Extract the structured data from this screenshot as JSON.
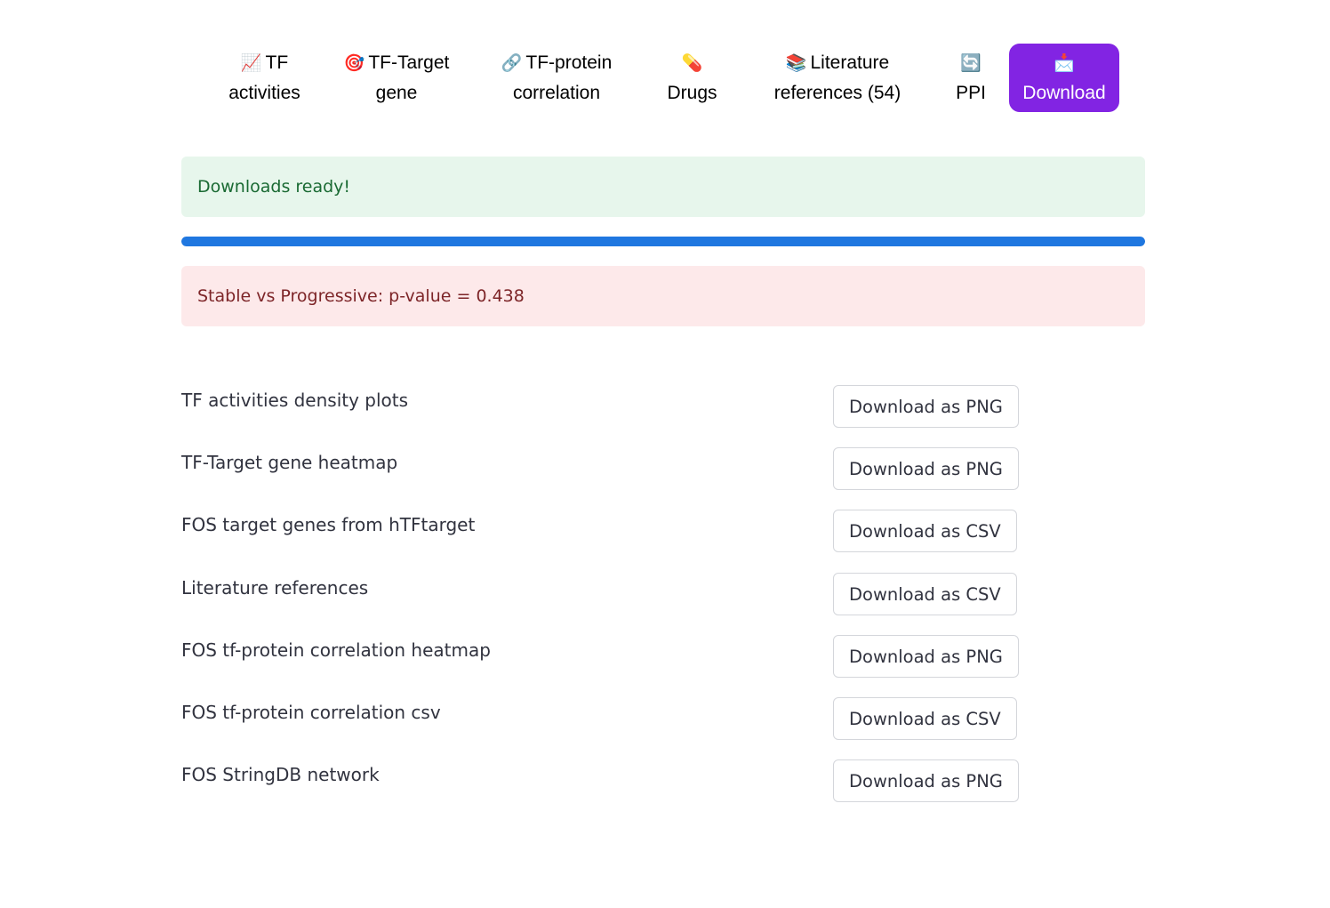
{
  "nav": {
    "tabs": [
      {
        "icon": "📈",
        "icon_name": "chart-increasing-icon",
        "line1": "TF",
        "line2": "activities"
      },
      {
        "icon": "🎯",
        "icon_name": "target-icon",
        "line1": "TF-Target",
        "line2": "gene"
      },
      {
        "icon": "🔗",
        "icon_name": "link-icon",
        "line1": "TF-protein",
        "line2": "correlation"
      },
      {
        "icon": "💊",
        "icon_name": "pill-icon",
        "line1": "",
        "line2": "Drugs"
      },
      {
        "icon": "📚",
        "icon_name": "books-icon",
        "line1": "Literature",
        "line2": "references (54)"
      },
      {
        "icon": "🔄",
        "icon_name": "refresh-icon",
        "line1": "",
        "line2": "PPI"
      },
      {
        "icon": "📩",
        "icon_name": "envelope-arrow-icon",
        "line1": "",
        "line2": "Download"
      }
    ],
    "active_index": 6,
    "active_color": "#8224e3"
  },
  "status": {
    "success_message": "Downloads ready!",
    "progress_fraction": 1.0,
    "progress_color": "#1f77e0",
    "pvalue_message": "Stable vs Progressive: p-value = 0.438"
  },
  "downloads": [
    {
      "label": "TF activities density plots",
      "button": "Download as PNG"
    },
    {
      "label": "TF-Target gene heatmap",
      "button": "Download as PNG"
    },
    {
      "label": "FOS target genes from hTFtarget",
      "button": "Download as CSV"
    },
    {
      "label": "Literature references",
      "button": "Download as CSV"
    },
    {
      "label": "FOS tf-protein correlation heatmap",
      "button": "Download as PNG"
    },
    {
      "label": "FOS tf-protein correlation csv",
      "button": "Download as CSV"
    },
    {
      "label": "FOS StringDB network",
      "button": "Download as PNG"
    }
  ]
}
